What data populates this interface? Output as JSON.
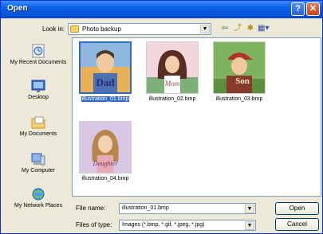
{
  "window": {
    "title": "Open"
  },
  "toolbar": {
    "lookin_label": "Look in:",
    "lookin_value": "Photo backup"
  },
  "places": [
    {
      "label": "My Recent Documents",
      "icon": "recent-documents-icon"
    },
    {
      "label": "Desktop",
      "icon": "desktop-icon"
    },
    {
      "label": "My Documents",
      "icon": "my-documents-icon"
    },
    {
      "label": "My Computer",
      "icon": "my-computer-icon"
    },
    {
      "label": "My Network Places",
      "icon": "network-places-icon"
    }
  ],
  "files": [
    {
      "name": "illustration_01.bmp",
      "caption": "Dad",
      "selected": true
    },
    {
      "name": "illustration_02.bmp",
      "caption": "Mom",
      "selected": false
    },
    {
      "name": "illustration_03.bmp",
      "caption": "Son",
      "selected": false
    },
    {
      "name": "illustration_04.bmp",
      "caption": "Daughter",
      "selected": false
    }
  ],
  "form": {
    "filename_label": "File name:",
    "filename_value": "illustration_01.bmp",
    "filetype_label": "Files of type:",
    "filetype_value": "Images (*.bmp, *.gif, *.jpeg, *.jpg)",
    "open_label": "Open",
    "cancel_label": "Cancel"
  }
}
